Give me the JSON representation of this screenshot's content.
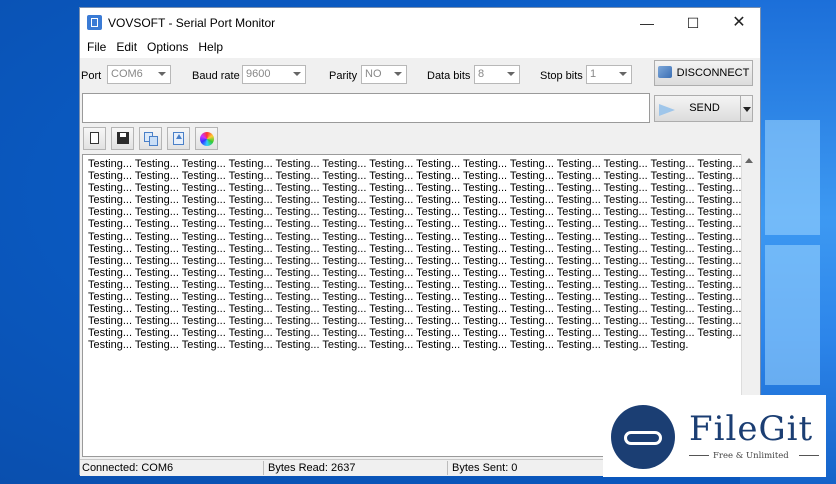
{
  "window": {
    "title": "VOVSOFT - Serial Port Monitor"
  },
  "menu": [
    "File",
    "Edit",
    "Options",
    "Help"
  ],
  "settings": {
    "port_label": "Port",
    "port_value": "COM6",
    "baud_label": "Baud rate",
    "baud_value": "9600",
    "parity_label": "Parity",
    "parity_value": "NO",
    "databits_label": "Data bits",
    "databits_value": "8",
    "stopbits_label": "Stop bits",
    "stopbits_value": "1"
  },
  "buttons": {
    "disconnect": "DISCONNECT",
    "send": "SEND"
  },
  "send_input": {
    "value": ""
  },
  "log": {
    "text": "Testing... Testing... Testing... Testing... Testing... Testing... Testing... Testing... Testing... Testing... Testing... Testing... Testing... Testing... Testing... Testing... Testing... Testing... Testing... Testing... Testing... Testing... Testing... Testing... Testing... Testing... Testing... Testing... Testing... Testing... Testing... Testing... Testing... Testing... Testing... Testing... Testing... Testing... Testing... Testing... Testing... Testing... Testing... Testing... Testing... Testing... Testing... Testing... Testing... Testing... Testing... Testing... Testing... Testing... Testing... Testing... Testing... Testing... Testing... Testing... Testing... Testing... Testing... Testing... Testing... Testing... Testing... Testing... Testing... Testing... Testing... Testing... Testing... Testing... Testing... Testing... Testing... Testing... Testing... Testing... Testing... Testing... Testing... Testing... Testing... Testing... Testing... Testing... Testing... Testing... Testing... Testing... Testing... Testing... Testing... Testing... Testing... Testing... Testing... Testing... Testing... Testing... Testing... Testing... Testing... Testing... Testing... Testing... Testing... Testing... Testing... Testing... Testing... Testing... Testing... Testing... Testing... Testing... Testing... Testing... Testing... Testing... Testing... Testing... Testing... Testing... Testing... Testing... Testing... Testing... Testing... Testing... Testing... Testing... Testing... Testing... Testing... Testing... Testing... Testing... Testing... Testing... Testing... Testing... Testing... Testing... Testing... Testing... Testing... Testing... Testing... Testing... Testing... Testing... Testing... Testing... Testing... Testing... Testing... Testing... Testing... Testing... Testing... Testing... Testing... Testing... Testing... Testing... Testing... Testing... Testing... Testing... Testing... Testing... Testing... Testing... Testing... Testing... Testing... Testing... Testing... Testing... Testing... Testing... Testing... Testing... Testing... Testing... Testing... Testing... Testing... Testing... Testing... Testing... Testing... Testing... Testing... Testing... Testing... Testing... Testing... Testing... Testing... Testing... Testing... Testing... Testing... Testing... Testing... Testing... Testing... Testing... Testing... Testing... Testing... Testing... Testing... Testing... Testing... Testing... Testing... Testing... Testing."
  },
  "status": {
    "connection": "Connected: COM6",
    "bytes_read": "Bytes Read: 2637",
    "bytes_sent": "Bytes Sent: 0"
  },
  "watermark": {
    "brand": "FileGit",
    "tagline": "Free & Unlimited"
  },
  "icons": [
    "new-file-icon",
    "save-icon",
    "copy-icon",
    "export-icon",
    "color-wheel-icon",
    "send-arrow-icon",
    "disconnect-icon"
  ],
  "colors": {
    "accent": "#1b3e73",
    "desktop": "#0a5bc4"
  }
}
